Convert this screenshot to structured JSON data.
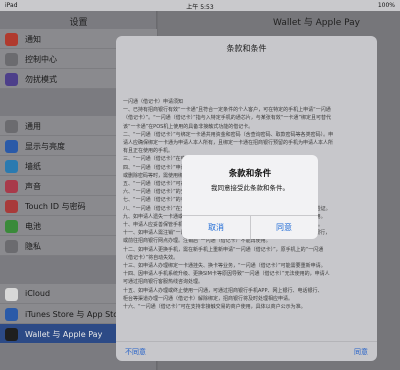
{
  "status_bar": {
    "device": "iPad",
    "time": "上午 5:53",
    "battery": "100%"
  },
  "sidebar": {
    "title": "设置",
    "items": [
      {
        "label": "通知",
        "icon": "notifications-icon",
        "color": "#b03a2e"
      },
      {
        "label": "控制中心",
        "icon": "control-center-icon",
        "color": "#6b6b6f"
      },
      {
        "label": "勿扰模式",
        "icon": "moon-icon",
        "color": "#4d3f8a"
      },
      {
        "label": "通用",
        "icon": "gear-icon",
        "color": "#6b6b6f"
      },
      {
        "label": "显示与亮度",
        "icon": "brightness-icon",
        "color": "#2a5aa8"
      },
      {
        "label": "墙纸",
        "icon": "wallpaper-icon",
        "color": "#2a7ab0"
      },
      {
        "label": "声音",
        "icon": "sound-icon",
        "color": "#a83a4a"
      },
      {
        "label": "Touch ID 与密码",
        "icon": "fingerprint-icon",
        "color": "#a83a3a"
      },
      {
        "label": "电池",
        "icon": "battery-icon",
        "color": "#3a8a3a"
      },
      {
        "label": "隐私",
        "icon": "privacy-icon",
        "color": "#6b6b6f"
      },
      {
        "label": "iCloud",
        "icon": "icloud-icon",
        "color": "#d8d8d8"
      },
      {
        "label": "iTunes Store 与 App Store",
        "icon": "app-store-icon",
        "color": "#2a5aa8"
      },
      {
        "label": "Wallet 与 Apple Pay",
        "icon": "wallet-icon",
        "color": "#1f1f1f"
      }
    ]
  },
  "detail": {
    "title": "Wallet 与 Apple Pay"
  },
  "sheet": {
    "title": "条款和条件",
    "disagree": "不同意",
    "agree": "同意",
    "lines": [
      "一闪通（借记卡）申请须知",
      "一、已持有招商银行有效“一卡通”且符合一定条件的个人客户，可在特定的手机上申请“一闪通",
      "（借记卡）”。“一闪通（借记卡）”指与入特定手机的通芯片，与某张有效“一卡通”绑定且可替代",
      "该“一卡通”在POS机上使用的具备非接触式功能的借记卡。",
      "二、“一闪通（借记卡）”与绑定一卡通共用资金和密码（含查询密码、取款密码等各类密码）。申",
      "请人应确保绑定一卡通为申请人本人所有，且绑定一卡通在招商银行预留的手机为申请人本人所",
      "有且正在使用的手机。",
      "三、“一闪通（借记卡）”在申请、使用过程中的相关规则，适用于一卡通的相关规则。",
      "四、“一闪通（借记卡）”申请成功后即可使用，您在使用“一闪通（借记卡）”修改",
      "或删除密码等时，需使用绑定一卡通的密码进行。",
      "五、“一闪通（借记卡）”可在支持非接触式交易的POS机上办理业务。",
      "六、“一闪通（借记卡）”的交易限额与绑定一卡通的交易限额一致。",
      "七、“一闪通（借记卡）”的有效期与绑定一卡通有效期一致。",
      "八、“一闪通（借记卡）”在交易时，使用的是手机中的安全芯片，需使用一卡通密码进行验证。",
      "九、如申请人遗失一卡通或绑定一卡通注销，“一闪通（借记卡）”亦随之失效，不能再使用。",
      "十、申请人应妥善保管手机，如因手机遗失、被盗等原因造成损失的，由申请人自行承担。",
      "十一、如申请人需注销“一闪通（借记卡）”，可通过招商银行手机APP、网上银行、电话银行，",
      "或前往招商银行网点办理。注销后“一闪通（借记卡）”不能再使用。",
      "十二、如申请人更换手机，需在新手机上重新申请“一闪通（借记卡）”，原手机上的“一闪通",
      "（借记卡）”将自动失效。",
      "十三、如申请人办理绑定一卡通挂失、换卡等业务，“一闪通（借记卡）”可能需要重新申请。",
      "十四、因申请人手机系统升级、更换SIM卡等原因导致“一闪通（借记卡）”无法使用的，申请人",
      "可通过招商银行客服热线咨询处理。",
      "十五、如申请人办理或终止使用一闪通，可通过招商银行手机APP、网上银行、电话银行、",
      "柜台等渠道办理一闪通（借记卡）解除绑定，招商银行将及时处理相应申请。",
      "十六、“一闪通（借记卡）”可在支持非接触交易的商户使用，具体以商户公示为准。"
    ]
  },
  "alert": {
    "title": "条款和条件",
    "message": "我同意接受此条款和条件。",
    "cancel": "取消",
    "confirm": "同意"
  }
}
